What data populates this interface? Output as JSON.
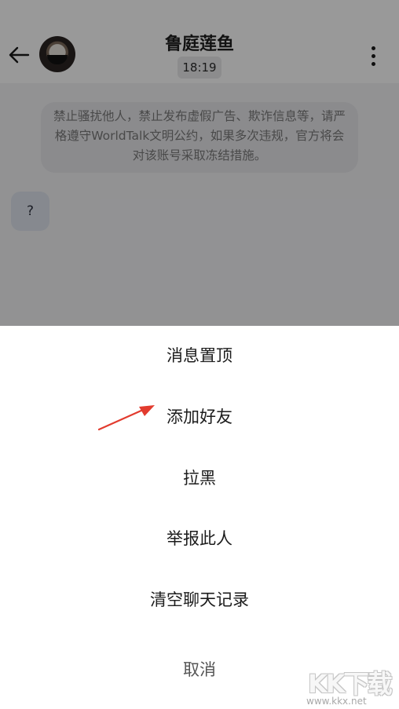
{
  "chat": {
    "title": "鲁庭莲鱼",
    "time": "18:19",
    "notice": "禁止骚扰他人，禁止发布虚假广告、欺诈信息等，请严格遵守WorldTalk文明公约，如果多次违规，官方将会对该账号采取冻结措施。",
    "message": "?",
    "back_icon": "arrow-left-icon",
    "more_icon": "more-vertical-icon"
  },
  "action_sheet": {
    "items": [
      "消息置顶",
      "添加好友",
      "拉黑",
      "举报此人",
      "清空聊天记录"
    ],
    "cancel": "取消"
  },
  "annotation": {
    "arrow_color": "#e23b2e"
  },
  "watermark": {
    "letters": "KK下载",
    "url": "www.kkx.net"
  },
  "colors": {
    "overlay": "rgba(0,0,0,0.40)",
    "sheet_bg": "#ffffff",
    "text": "#1c1c1c"
  }
}
